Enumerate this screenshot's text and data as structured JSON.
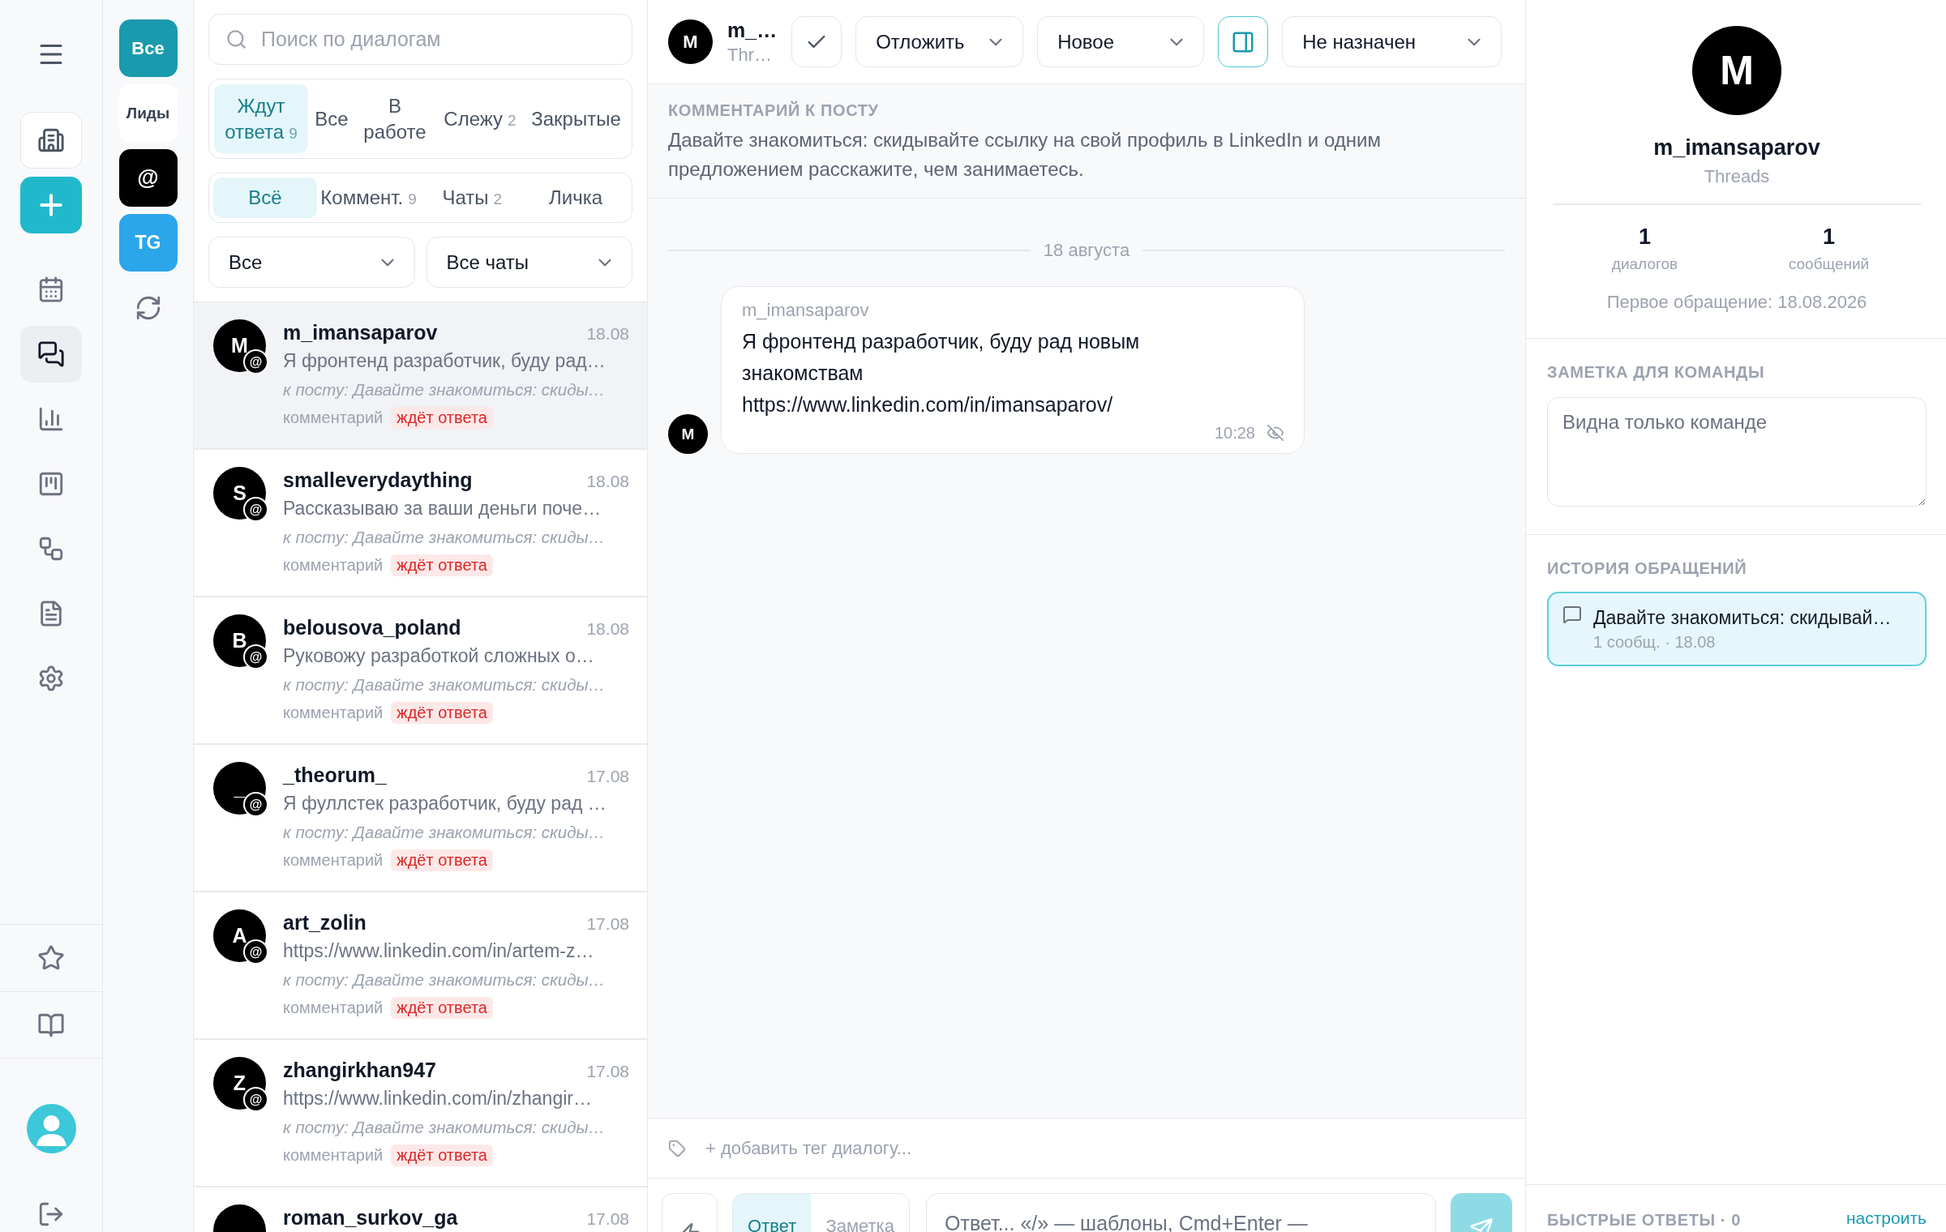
{
  "nav_rail": {
    "items": [
      {
        "kind": "workspace",
        "selected": false
      },
      {
        "kind": "create",
        "selected": false
      },
      {
        "kind": "link",
        "selected": false
      },
      {
        "kind": "link",
        "selected": true
      },
      {
        "kind": "link",
        "selected": false
      },
      {
        "kind": "link",
        "selected": false
      },
      {
        "kind": "link",
        "selected": false
      },
      {
        "kind": "link",
        "selected": false
      },
      {
        "kind": "link",
        "selected": false
      }
    ],
    "footer_items": [
      {
        "selected": false
      },
      {
        "selected": false
      }
    ]
  },
  "sources": [
    {
      "label": "Все",
      "color": "#1a9aad"
    },
    {
      "label": "Лиды",
      "color": "#ffffff"
    },
    {
      "label": "@",
      "color": "#000000"
    },
    {
      "label": "TG",
      "color": "#2ba6ea"
    }
  ],
  "search": {
    "placeholder": "Поиск по диалогам"
  },
  "status_tabs": [
    {
      "label": "Ждут ответа",
      "count": "9",
      "selected": true
    },
    {
      "label": "Все",
      "selected": false
    },
    {
      "label": "В работе",
      "selected": false
    },
    {
      "label": "Слежу",
      "count": "2",
      "selected": false
    },
    {
      "label": "Закрытые",
      "selected": false
    }
  ],
  "type_tabs": [
    {
      "label": "Всё",
      "selected": true
    },
    {
      "label": "Коммент.",
      "count": "9",
      "selected": false
    },
    {
      "label": "Чаты",
      "count": "2",
      "selected": false
    },
    {
      "label": "Личка",
      "selected": false
    }
  ],
  "filters": [
    {
      "value": "Все"
    },
    {
      "value": "Все чаты"
    }
  ],
  "conversations": [
    {
      "initial": "M",
      "badge": "@",
      "name": "m_imansaparov",
      "date": "18.08",
      "preview": "Я фронтенд разработчик, буду рад…",
      "post": "к посту: Давайте знакомиться: скиды…",
      "type": "комментарий",
      "status": "ждёт ответа",
      "selected": true
    },
    {
      "initial": "S",
      "badge": "@",
      "name": "smalleverydaything",
      "date": "18.08",
      "preview": "Рассказываю за ваши деньги поче…",
      "post": "к посту: Давайте знакомиться: скиды…",
      "type": "комментарий",
      "status": "ждёт ответа",
      "selected": false
    },
    {
      "initial": "B",
      "badge": "@",
      "name": "belousova_poland",
      "date": "18.08",
      "preview": "Руковожу разработкой сложных о…",
      "post": "к посту: Давайте знакомиться: скиды…",
      "type": "комментарий",
      "status": "ждёт ответа",
      "selected": false
    },
    {
      "initial": "_",
      "badge": "@",
      "name": "_theorum_",
      "date": "17.08",
      "preview": "Я фуллстек разработчик, буду рад …",
      "post": "к посту: Давайте знакомиться: скиды…",
      "type": "комментарий",
      "status": "ждёт ответа",
      "selected": false
    },
    {
      "initial": "A",
      "badge": "@",
      "name": "art_zolin",
      "date": "17.08",
      "preview": "https://www.linkedin.com/in/artem-z…",
      "post": "к посту: Давайте знакомиться: скиды…",
      "type": "комментарий",
      "status": "ждёт ответа",
      "selected": false
    },
    {
      "initial": "Z",
      "badge": "@",
      "name": "zhangirkhan947",
      "date": "17.08",
      "preview": "https://www.linkedin.com/in/zhangir…",
      "post": "к посту: Давайте знакомиться: скиды…",
      "type": "комментарий",
      "status": "ждёт ответа",
      "selected": false
    },
    {
      "name": "roman_surkov_ga",
      "date": "17.08",
      "selected": false
    }
  ],
  "chat": {
    "header": {
      "initial": "M",
      "name": "m_…",
      "platform": "Thr…",
      "snooze": "Отложить",
      "status": "Новое",
      "panel_toggle": {
        "on": true
      },
      "assignee": "Не назначен"
    },
    "post": {
      "label": "КОММЕНТАРИЙ К ПОСТУ",
      "text": "Давайте знакомиться: скидывайте ссылку на свой профиль в LinkedIn и одним предложением расскажите, чем занимаетесь."
    },
    "date_divider": "18 августа",
    "messages": [
      {
        "initial": "M",
        "sender": "m_imansaparov",
        "text": "Я фронтенд разработчик, буду рад новым знакомствам\nhttps://www.linkedin.com/in/imansaparov/",
        "time": "10:28"
      }
    ],
    "tag_input": {
      "placeholder": "+ добавить тег диалогу..."
    },
    "composer": {
      "modes": [
        {
          "label": "Ответ",
          "selected": true
        },
        {
          "label": "Заметка",
          "selected": false
        }
      ],
      "placeholder": "Ответ... «/» — шаблоны, Cmd+Enter —",
      "send_button": {
        "disabled": true
      }
    }
  },
  "profile": {
    "initial": "M",
    "name": "m_imansaparov",
    "platform": "Threads",
    "stats": [
      {
        "value": "1",
        "label": "диалогов"
      },
      {
        "value": "1",
        "label": "сообщений"
      }
    ],
    "first_contact": "Первое обращение: 18.08.2026"
  },
  "team_note": {
    "label": "ЗАМЕТКА ДЛЯ КОМАНДЫ",
    "placeholder": "Видна только команде"
  },
  "history": {
    "label": "ИСТОРИЯ ОБРАЩЕНИЙ",
    "items": [
      {
        "title": "Давайте знакомиться: скидывай…",
        "meta": "1 сообщ. · 18.08",
        "selected": true
      }
    ]
  },
  "quick_replies": {
    "label": "БЫСТРЫЕ ОТВЕТЫ · 0",
    "link": "настроить"
  }
}
